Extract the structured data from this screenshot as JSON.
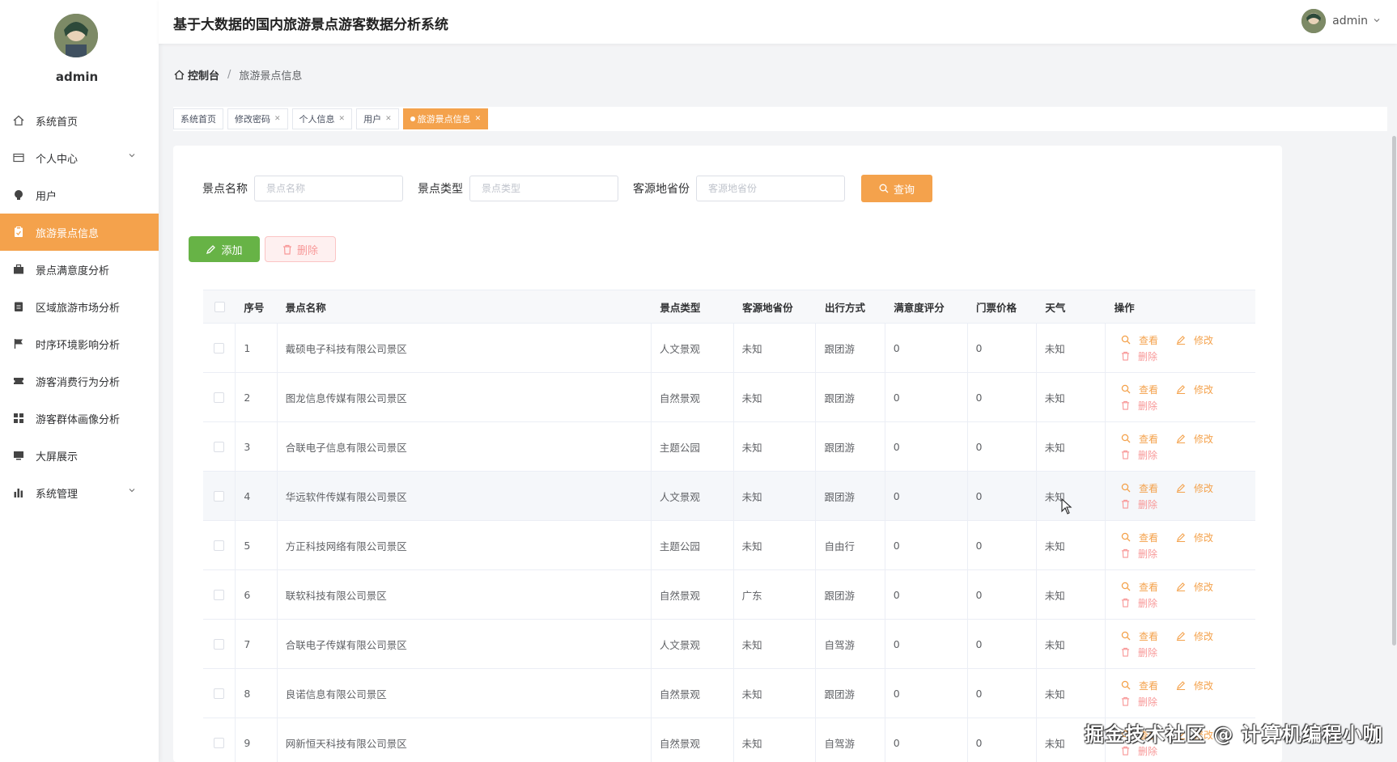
{
  "header": {
    "title": "基于大数据的国内旅游景点游客数据分析系统",
    "username": "admin"
  },
  "sidebar": {
    "profile_name": "admin",
    "items": [
      {
        "label": "系统首页",
        "icon": "home-icon",
        "active": false
      },
      {
        "label": "个人中心",
        "icon": "wallet-icon",
        "active": false,
        "expandable": true
      },
      {
        "label": "用户",
        "icon": "lightbulb-icon",
        "active": false
      },
      {
        "label": "旅游景点信息",
        "icon": "clipboard-icon",
        "active": true
      },
      {
        "label": "景点满意度分析",
        "icon": "briefcase-icon",
        "active": false
      },
      {
        "label": "区域旅游市场分析",
        "icon": "clipboard-icon",
        "active": false
      },
      {
        "label": "时序环境影响分析",
        "icon": "flag-icon",
        "active": false
      },
      {
        "label": "游客消费行为分析",
        "icon": "ticket-icon",
        "active": false
      },
      {
        "label": "游客群体画像分析",
        "icon": "grid-icon",
        "active": false
      },
      {
        "label": "大屏展示",
        "icon": "monitor-icon",
        "active": false
      },
      {
        "label": "系统管理",
        "icon": "bar-chart-icon",
        "active": false,
        "expandable": true
      }
    ]
  },
  "breadcrumb": {
    "home": "控制台",
    "separator": "/",
    "current": "旅游景点信息"
  },
  "tags": [
    {
      "label": "系统首页",
      "closable": false,
      "active": false
    },
    {
      "label": "修改密码",
      "closable": true,
      "active": false
    },
    {
      "label": "个人信息",
      "closable": true,
      "active": false
    },
    {
      "label": "用户",
      "closable": true,
      "active": false
    },
    {
      "label": "旅游景点信息",
      "closable": true,
      "active": true
    }
  ],
  "search": {
    "name_label": "景点名称",
    "name_placeholder": "景点名称",
    "type_label": "景点类型",
    "type_placeholder": "景点类型",
    "province_label": "客源地省份",
    "province_placeholder": "客源地省份",
    "query_label": "查询"
  },
  "actions": {
    "add_label": "添加",
    "delete_label": "删除"
  },
  "table": {
    "columns": [
      "序号",
      "景点名称",
      "景点类型",
      "客源地省份",
      "出行方式",
      "满意度评分",
      "门票价格",
      "天气",
      "操作"
    ],
    "ops": {
      "view": "查看",
      "edit": "修改",
      "delete": "删除"
    },
    "rows": [
      {
        "idx": "1",
        "name": "戴硕电子科技有限公司景区",
        "type": "人文景观",
        "province": "未知",
        "trip": "跟团游",
        "score": "0",
        "price": "0",
        "weather": "未知"
      },
      {
        "idx": "2",
        "name": "图龙信息传媒有限公司景区",
        "type": "自然景观",
        "province": "未知",
        "trip": "跟团游",
        "score": "0",
        "price": "0",
        "weather": "未知"
      },
      {
        "idx": "3",
        "name": "合联电子信息有限公司景区",
        "type": "主题公园",
        "province": "未知",
        "trip": "跟团游",
        "score": "0",
        "price": "0",
        "weather": "未知"
      },
      {
        "idx": "4",
        "name": "华远软件传媒有限公司景区",
        "type": "人文景观",
        "province": "未知",
        "trip": "跟团游",
        "score": "0",
        "price": "0",
        "weather": "未知"
      },
      {
        "idx": "5",
        "name": "方正科技网络有限公司景区",
        "type": "主题公园",
        "province": "未知",
        "trip": "自由行",
        "score": "0",
        "price": "0",
        "weather": "未知"
      },
      {
        "idx": "6",
        "name": "联软科技有限公司景区",
        "type": "自然景观",
        "province": "广东",
        "trip": "跟团游",
        "score": "0",
        "price": "0",
        "weather": "未知"
      },
      {
        "idx": "7",
        "name": "合联电子传媒有限公司景区",
        "type": "人文景观",
        "province": "未知",
        "trip": "自驾游",
        "score": "0",
        "price": "0",
        "weather": "未知"
      },
      {
        "idx": "8",
        "name": "良诺信息有限公司景区",
        "type": "自然景观",
        "province": "未知",
        "trip": "跟团游",
        "score": "0",
        "price": "0",
        "weather": "未知"
      },
      {
        "idx": "9",
        "name": "网新恒天科技有限公司景区",
        "type": "自然景观",
        "province": "未知",
        "trip": "自驾游",
        "score": "0",
        "price": "0",
        "weather": "未知"
      }
    ]
  },
  "watermark": "掘金技术社区 @ 计算机编程小咖",
  "colors": {
    "accent": "#f4a24c",
    "success": "#67b346",
    "danger": "#f89898"
  }
}
